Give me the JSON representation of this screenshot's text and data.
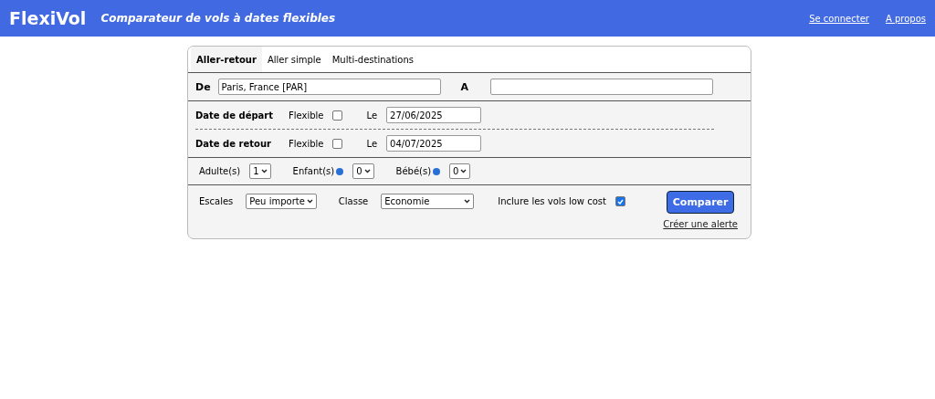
{
  "header": {
    "logo": "FlexiVol",
    "tagline": "Comparateur de vols à dates flexibles",
    "links": [
      "Se connecter",
      "A propos"
    ]
  },
  "tabs": [
    {
      "label": "Aller-retour",
      "selected": true
    },
    {
      "label": "Aller simple",
      "selected": false
    },
    {
      "label": "Multi-destinations",
      "selected": false
    }
  ],
  "route": {
    "from_label": "De",
    "from_value": "Paris, France [PAR]",
    "to_label": "A"
  },
  "dates": [
    {
      "label": "Date de départ",
      "flexible_label": "Flexible",
      "flexible": false,
      "date_label": "Le",
      "date": "27/06/2025"
    },
    {
      "label": "Date de retour",
      "flexible_label": "Flexible",
      "flexible": false,
      "date_label": "Le",
      "date": "04/07/2025"
    }
  ],
  "passengers": [
    {
      "label": "Adulte(s)",
      "info": false,
      "value": "1"
    },
    {
      "label": "Enfant(s)",
      "info": true,
      "value": "0"
    },
    {
      "label": "Bébé(s)",
      "info": true,
      "value": "0"
    }
  ],
  "options": {
    "stops_label": "Escales",
    "stops_value": "Peu importe",
    "class_label": "Classe",
    "class_value": "Economie",
    "lowcost_label": "Inclure les vols low cost",
    "lowcost": true
  },
  "submit": "Comparer",
  "alert_link": "Créer une alerte"
}
